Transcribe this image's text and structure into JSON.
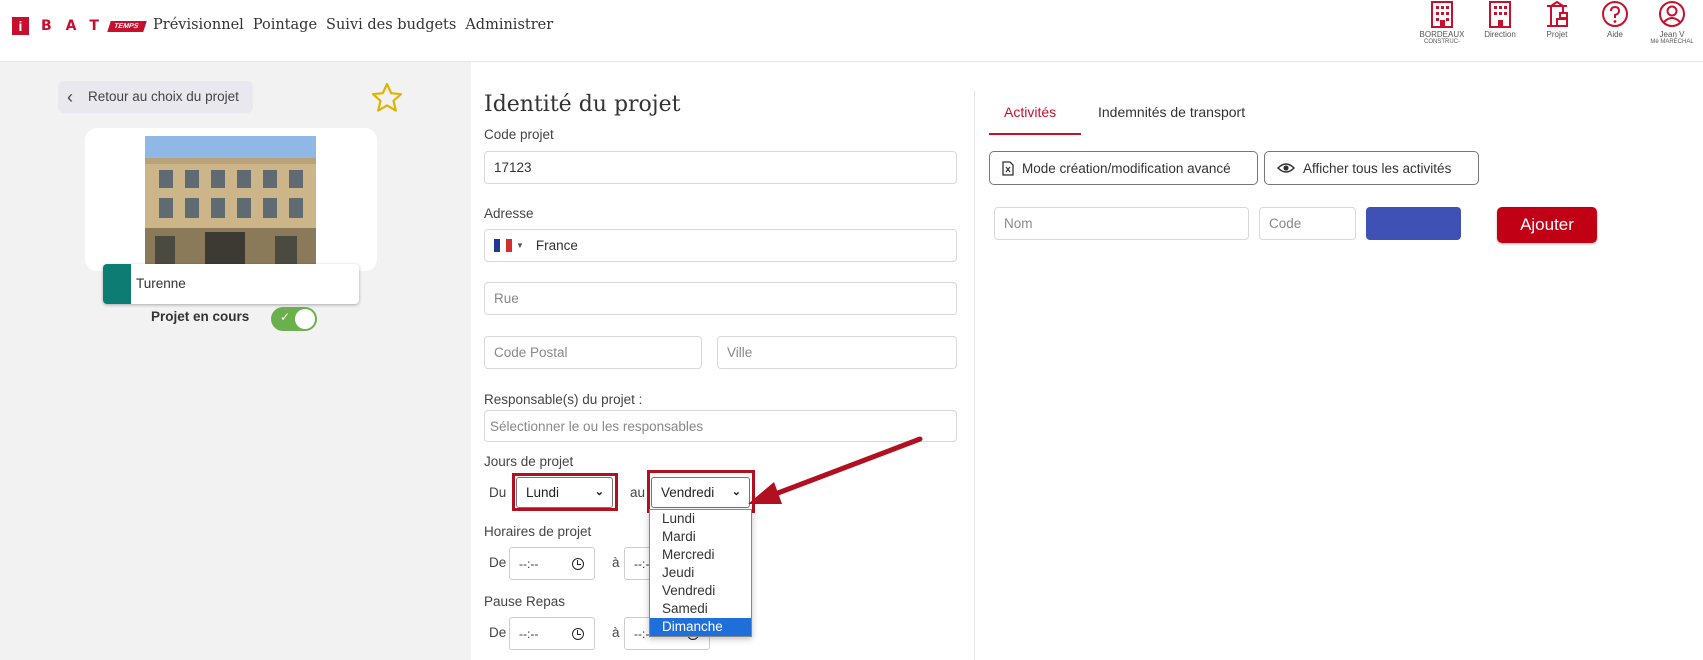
{
  "logo": {
    "i": "i",
    "bat": "BAT",
    "temps": "TEMPS"
  },
  "nav": [
    "Prévisionnel",
    "Pointage",
    "Suivi des budgets",
    "Administrer"
  ],
  "top_icons": [
    {
      "name": "building-icon",
      "label": "BORDEAUX",
      "label2": "CONSTRUC-"
    },
    {
      "name": "building-icon",
      "label": "Direction",
      "label2": ""
    },
    {
      "name": "crane-icon",
      "label": "Projet",
      "label2": ""
    },
    {
      "name": "help-icon",
      "label": "Aide",
      "label2": ""
    },
    {
      "name": "user-icon",
      "label": "Jean V",
      "label2": "Mé MARÉCHAL"
    }
  ],
  "left": {
    "back_label": "Retour au choix du projet",
    "project_name": "Turenne",
    "project_color": "#0d7d73",
    "status_label": "Projet en cours",
    "status_on": true
  },
  "form": {
    "title": "Identité du projet",
    "code_label": "Code projet",
    "code_value": "17123",
    "address_label": "Adresse",
    "country": "France",
    "street_placeholder": "Rue",
    "postal_placeholder": "Code Postal",
    "city_placeholder": "Ville",
    "resp_label": "Responsable(s) du projet :",
    "resp_placeholder": "Sélectionner le ou les responsables",
    "days_label": "Jours de projet",
    "du": "Du",
    "au": "au",
    "day_from": "Lundi",
    "day_to": "Vendredi",
    "day_options": [
      "Lundi",
      "Mardi",
      "Mercredi",
      "Jeudi",
      "Vendredi",
      "Samedi",
      "Dimanche"
    ],
    "highlighted_option": "Dimanche",
    "hours_label": "Horaires de projet",
    "de": "De",
    "a": "à",
    "time_placeholder": "--:--",
    "pause_label": "Pause Repas"
  },
  "right": {
    "tabs": [
      "Activités",
      "Indemnités de transport"
    ],
    "active_tab": "Activités",
    "advanced_btn": "Mode création/modification avancé",
    "show_all_btn": "Afficher tous les activités",
    "name_placeholder": "Nom",
    "code_placeholder": "Code",
    "color_value": "#3f51b5",
    "add_btn": "Ajouter"
  },
  "colors": {
    "brand": "#c8102e",
    "annotation": "#b01020",
    "toggle": "#6ab04c"
  }
}
